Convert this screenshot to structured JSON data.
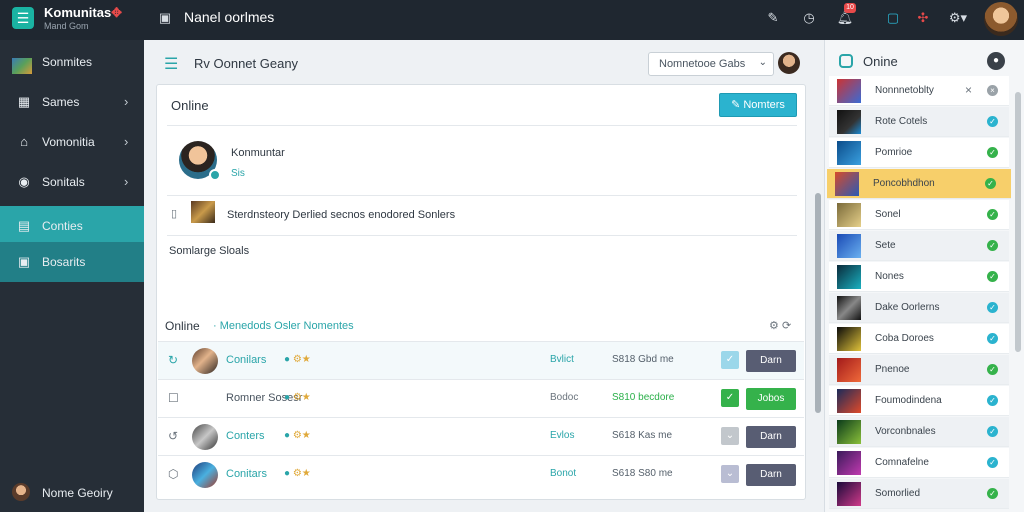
{
  "app": {
    "title": "Komunitas",
    "subtitle": "Mand Gom"
  },
  "topbar": {
    "page_title": "Nanel oorlmes",
    "notification_count": "10"
  },
  "sidebar": {
    "items": [
      {
        "label": "Sonmites",
        "icon": "app-thumbnail"
      },
      {
        "label": "Sames",
        "icon": "dashboard-icon"
      },
      {
        "label": "Vomonitia",
        "icon": "home-icon"
      },
      {
        "label": "Sonitals",
        "icon": "gauge-icon"
      },
      {
        "label": "Conties",
        "icon": "document-icon"
      },
      {
        "label": "Bosarits",
        "icon": "card-icon"
      }
    ],
    "footer": "Nome Geoiry"
  },
  "header": {
    "title": "Rv Oonnet Geany",
    "select_value": "Nomnetooe Gabs"
  },
  "card": {
    "title": "Online",
    "primary_button": "Nomters",
    "profile": {
      "name": "Konmuntar",
      "sub": "Sis"
    },
    "post_text": "Sterdnsteory Derlied secnos enodored Sonlers",
    "sub_label": "Somlarge Sloals",
    "section": {
      "title": "Online",
      "link": "Menedods Osler Nomentes"
    }
  },
  "rows": [
    {
      "name": "Conilars",
      "name_color": "#2aa5a9",
      "role": "Bvlict",
      "role_color": "#2aa5a9",
      "date": "S818 Gbd me",
      "date_color": "#55606b",
      "action": "Darn",
      "action_color": "#585d73",
      "tick_color": "#9bd7ea",
      "tick_glyph": "✓",
      "state_glyph": "↻",
      "state_color": "#2aa5a9",
      "thumb": "linear-gradient(135deg,#5a3b2a,#e2b38b 45%,#2b2420)",
      "highlight": true
    },
    {
      "name": "Romner Sosesr",
      "name_color": "#4a5560",
      "role": "Bodoc",
      "role_color": "#6b747d",
      "date": "S810 becdore",
      "date_color": "#2bb04a",
      "action": "Jobos",
      "action_color": "#35b24b",
      "tick_color": "#35b24b",
      "tick_glyph": "✓",
      "state_glyph": "☐",
      "state_color": "#6b747d",
      "thumb": "",
      "highlight": false
    },
    {
      "name": "Conters",
      "name_color": "#2aa5a9",
      "role": "Evlos",
      "role_color": "#2aa5a9",
      "date": "S618 Kas me",
      "date_color": "#55606b",
      "action": "Darn",
      "action_color": "#585d73",
      "tick_color": "#c2c7cc",
      "tick_glyph": "⌄",
      "state_glyph": "↺",
      "state_color": "#6b747d",
      "thumb": "linear-gradient(135deg,#444,#c7c7c7 50%,#333)",
      "highlight": false
    },
    {
      "name": "Conitars",
      "name_color": "#2aa5a9",
      "role": "Bonot",
      "role_color": "#2aa5a9",
      "date": "S618 S80 me",
      "date_color": "#55606b",
      "action": "Darn",
      "action_color": "#585d73",
      "tick_color": "#b9bdd3",
      "tick_glyph": "⌄",
      "state_glyph": "⬡",
      "state_color": "#6b747d",
      "thumb": "linear-gradient(135deg,#1e3a7a,#4ab0e0 50%,#a23a2a)",
      "highlight": false
    }
  ],
  "right_panel": {
    "title": "Onine",
    "items": [
      {
        "label": "Nonnnetoblty",
        "thumb": "linear-gradient(135deg,#c33,#3a6bd5)",
        "check_color": "#9aa2a8",
        "glyph": "×",
        "sel": false
      },
      {
        "label": "Rote Cotels",
        "thumb": "linear-gradient(135deg,#111,#333 60%,#1a8bd5)",
        "check_color": "#2bb3cf",
        "glyph": "✓",
        "sel": false
      },
      {
        "label": "Pomrioe",
        "thumb": "linear-gradient(135deg,#0b4c8a,#3aa0e0)",
        "check_color": "#35b24b",
        "glyph": "✓",
        "sel": false
      },
      {
        "label": "Poncobhdhon",
        "thumb": "linear-gradient(135deg,#d64a2a,#2a5ab5)",
        "check_color": "#35b24b",
        "glyph": "✓",
        "sel": true
      },
      {
        "label": "Sonel",
        "thumb": "linear-gradient(135deg,#7a6a3a,#e6d08a)",
        "check_color": "#35b24b",
        "glyph": "✓",
        "sel": false
      },
      {
        "label": "Sete",
        "thumb": "linear-gradient(135deg,#1a4ab5,#6ab0f0)",
        "check_color": "#35b24b",
        "glyph": "✓",
        "sel": false
      },
      {
        "label": "Nones",
        "thumb": "linear-gradient(135deg,#0a2a3a,#1ab0c0)",
        "check_color": "#35b24b",
        "glyph": "✓",
        "sel": false
      },
      {
        "label": "Dake Oorlerns",
        "thumb": "linear-gradient(135deg,#111,#888 50%,#111)",
        "check_color": "#2bb3cf",
        "glyph": "✓",
        "sel": false
      },
      {
        "label": "Coba Doroes",
        "thumb": "linear-gradient(135deg,#0a0a0a,#e0c23a)",
        "check_color": "#2bb3cf",
        "glyph": "✓",
        "sel": false
      },
      {
        "label": "Pnenoe",
        "thumb": "linear-gradient(135deg,#a21a1a,#f06a3a)",
        "check_color": "#35b24b",
        "glyph": "✓",
        "sel": false
      },
      {
        "label": "Foumodindena",
        "thumb": "linear-gradient(135deg,#1a2a5a,#e04a2a)",
        "check_color": "#2bb3cf",
        "glyph": "✓",
        "sel": false
      },
      {
        "label": "Vorconbnales",
        "thumb": "linear-gradient(135deg,#0a3a1a,#8ac03a)",
        "check_color": "#2bb3cf",
        "glyph": "✓",
        "sel": false
      },
      {
        "label": "Comnafelne",
        "thumb": "linear-gradient(135deg,#3a1a5a,#c03ab0)",
        "check_color": "#2bb3cf",
        "glyph": "✓",
        "sel": false
      },
      {
        "label": "Somorlied",
        "thumb": "linear-gradient(135deg,#1a0a3a,#d03a8a)",
        "check_color": "#35b24b",
        "glyph": "✓",
        "sel": false
      }
    ]
  }
}
